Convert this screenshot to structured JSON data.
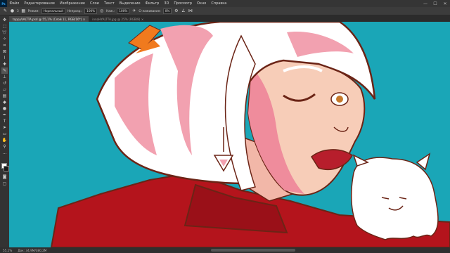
{
  "app": {
    "logo": "Ps"
  },
  "menu": [
    "Файл",
    "Редактирование",
    "Изображение",
    "Слои",
    "Текст",
    "Выделение",
    "Фильтр",
    "3D",
    "Просмотр",
    "Окно",
    "Справка"
  ],
  "window_controls": {
    "minimize": "—",
    "maximize": "☐",
    "close": "✕"
  },
  "options": {
    "brush_size": "3",
    "mode_label": "Режим:",
    "mode_value": "Нормальный",
    "opacity_label": "Непрозр.:",
    "opacity_value": "100%",
    "flow_label": "Наж.:",
    "flow_value": "100%",
    "smoothing_label": "Сглаживание:",
    "smoothing_value": "0%"
  },
  "tabs": [
    {
      "label": "toppyVALTTA.psd @ 55,1% (Слой 11, RGB/16*) ×",
      "active": true
    },
    {
      "label": "innaHYALTTA.jpg @ 25% (RGB/8) ×",
      "active": false
    }
  ],
  "status": {
    "zoom": "55,1%",
    "doc_size": "Док: 34,9M/380,2M"
  },
  "tools": [
    "move-icon",
    "marquee-icon",
    "lasso-icon",
    "quick-select-icon",
    "crop-icon",
    "frame-icon",
    "eyedropper-icon",
    "healing-icon",
    "brush-icon",
    "stamp-icon",
    "history-brush-icon",
    "eraser-icon",
    "gradient-icon",
    "blur-icon",
    "dodge-icon",
    "pen-icon",
    "type-icon",
    "path-select-icon",
    "shape-icon",
    "hand-icon",
    "zoom-icon",
    "more-icon"
  ],
  "colors": {
    "canvas_bg": "#1aa6b7",
    "outline": "#6b2416",
    "hair_white": "#ffffff",
    "hair_pink": "#f2a1b0",
    "skin": "#f7cdb8",
    "skin_shadow": "#ef8c9c",
    "lips": "#b71e2c",
    "shirt": "#b4141c",
    "feather": "#f07a1e",
    "ghost": "#ffffff"
  }
}
